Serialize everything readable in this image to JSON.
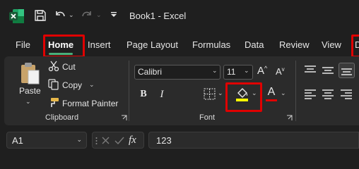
{
  "window": {
    "title": "Book1  -  Excel"
  },
  "tabs": {
    "file": "File",
    "home": "Home",
    "insert": "Insert",
    "page_layout": "Page Layout",
    "formulas": "Formulas",
    "data": "Data",
    "review": "Review",
    "view": "View",
    "developer_partial": "D"
  },
  "clipboard": {
    "paste": "Paste",
    "cut": "Cut",
    "copy": "Copy",
    "format_painter": "Format Painter",
    "group_label": "Clipboard"
  },
  "font": {
    "family": "Calibri",
    "size": "11",
    "grow_glyph": "A",
    "shrink_glyph": "A",
    "bold_glyph": "B",
    "italic_glyph": "I",
    "font_color_glyph": "A",
    "group_label": "Font",
    "highlight_color": "#ffff00",
    "font_color": "#e00000"
  },
  "formula_bar": {
    "name_box": "A1",
    "fx": "fx",
    "value": "123"
  },
  "colors": {
    "excel_green": "#1d6f42",
    "home_underline": "#4caf7a",
    "annotation_red": "#e00000"
  },
  "icons": [
    "excel-logo-icon",
    "save-icon",
    "undo-icon",
    "redo-icon",
    "customize-qat-icon",
    "paste-icon",
    "cut-icon",
    "copy-icon",
    "format-painter-icon",
    "grow-font-icon",
    "shrink-font-icon",
    "borders-icon",
    "fill-color-icon",
    "font-color-icon",
    "align-top-icon",
    "align-middle-icon",
    "align-bottom-icon",
    "align-left-icon",
    "align-center-icon",
    "align-right-icon",
    "cancel-icon",
    "enter-icon",
    "dialog-launcher-icon"
  ]
}
